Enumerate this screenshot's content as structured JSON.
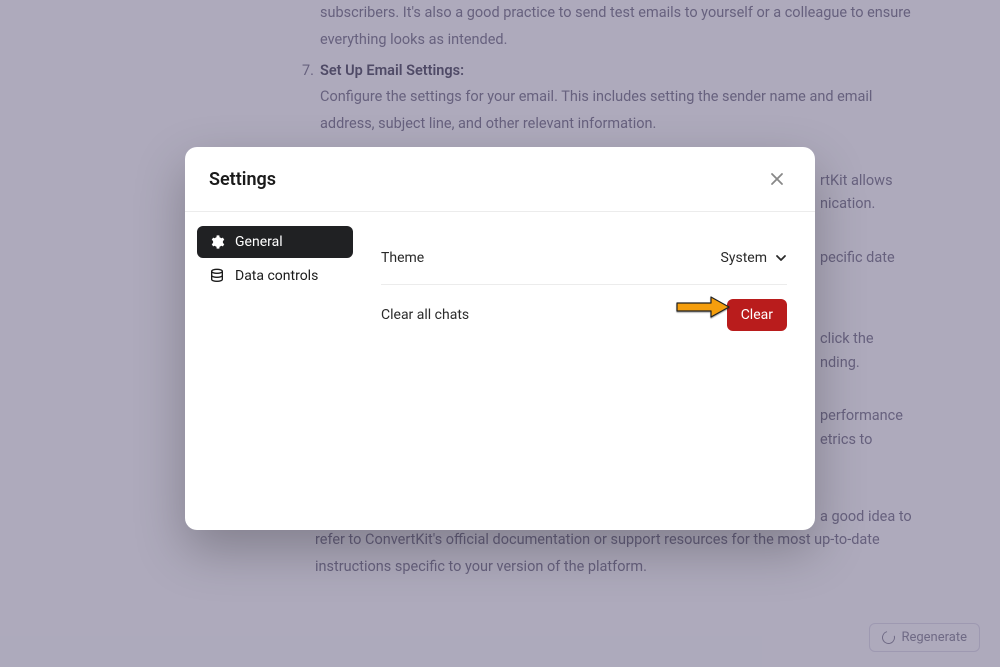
{
  "background": {
    "preview_text": "subscribers. It's also a good practice to send test emails to yourself or a colleague to ensure everything looks as intended.",
    "item7_num": "7.",
    "item7_title": "Set Up Email Settings:",
    "item7_text": "Configure the settings for your email. This includes setting the sender name and email address, subject line, and other relevant information.",
    "rt_allow_frag": "rtKit allows",
    "rt_nication_frag": "nication.",
    "rt_date_frag": "pecific date",
    "rt_click_frag": "click the",
    "rt_nding_frag": "nding.",
    "rt_perf_frag": "performance",
    "rt_metrics_frag": "etrics to",
    "rt_good_frag": "a good idea to",
    "bottom_text": "refer to ConvertKit's official documentation or support resources for the most up-to-date instructions specific to your version of the platform.",
    "regenerate_label": "Regenerate"
  },
  "modal": {
    "title": "Settings",
    "sidebar": {
      "items": [
        {
          "label": "General"
        },
        {
          "label": "Data controls"
        }
      ]
    },
    "settings": {
      "theme_label": "Theme",
      "theme_value": "System",
      "clear_label": "Clear all chats",
      "clear_button": "Clear"
    }
  }
}
